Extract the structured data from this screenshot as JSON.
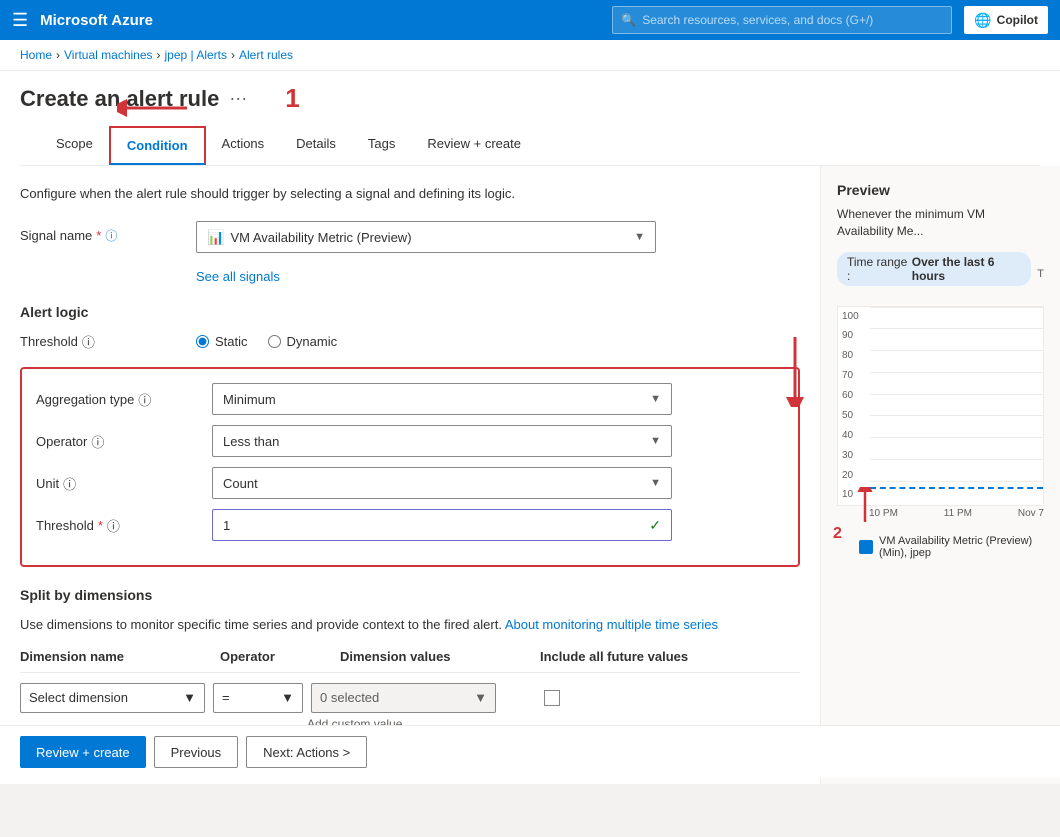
{
  "topnav": {
    "hamburger": "☰",
    "title": "Microsoft Azure",
    "search_placeholder": "Search resources, services, and docs (G+/)",
    "copilot_label": "Copilot"
  },
  "breadcrumb": {
    "items": [
      "Home",
      "Virtual machines",
      "jpep | Alerts",
      "Alert rules"
    ]
  },
  "page": {
    "title": "Create an alert rule",
    "dots": "···",
    "description": "Configure when the alert rule should trigger by selecting a signal and defining its logic."
  },
  "tabs": {
    "items": [
      "Scope",
      "Condition",
      "Actions",
      "Details",
      "Tags",
      "Review + create"
    ],
    "active": "Condition"
  },
  "signal": {
    "label": "Signal name",
    "required": "*",
    "value": "VM Availability Metric (Preview)",
    "see_signals_link": "See all signals"
  },
  "alert_logic": {
    "title": "Alert logic",
    "threshold": {
      "label": "Threshold",
      "options": [
        "Static",
        "Dynamic"
      ],
      "selected": "Static"
    },
    "aggregation_type": {
      "label": "Aggregation type",
      "value": "Minimum"
    },
    "operator": {
      "label": "Operator",
      "value": "Less than"
    },
    "unit": {
      "label": "Unit",
      "value": "Count"
    },
    "threshold_val": {
      "label": "Threshold",
      "required": "*",
      "value": "1"
    }
  },
  "split_by_dimensions": {
    "title": "Split by dimensions",
    "description": "Use dimensions to monitor specific time series and provide context to the fired alert.",
    "link_text": "About monitoring multiple time series",
    "columns": {
      "name": "Dimension name",
      "operator": "Operator",
      "values": "Dimension values",
      "future": "Include all future values"
    },
    "row": {
      "dimension_placeholder": "Select dimension",
      "operator_value": "=",
      "values_placeholder": "0 selected",
      "add_custom": "Add custom value"
    }
  },
  "preview": {
    "title": "Preview",
    "description": "Whenever the minimum VM Availability Me...",
    "time_range_label": "Time range :",
    "time_range_value": "Over the last 6 hours",
    "y_axis": [
      "100",
      "90",
      "80",
      "70",
      "60",
      "50",
      "40",
      "30",
      "20",
      "10"
    ],
    "x_labels": [
      "10 PM",
      "11 PM",
      "Nov 7"
    ],
    "legend_color": "#0078d4",
    "legend_label": "VM Availability Metric (Preview) (Min), jpep"
  },
  "footer": {
    "review_create": "Review + create",
    "previous": "Previous",
    "next": "Next: Actions >"
  },
  "annotations": {
    "one": "1",
    "two": "2"
  }
}
